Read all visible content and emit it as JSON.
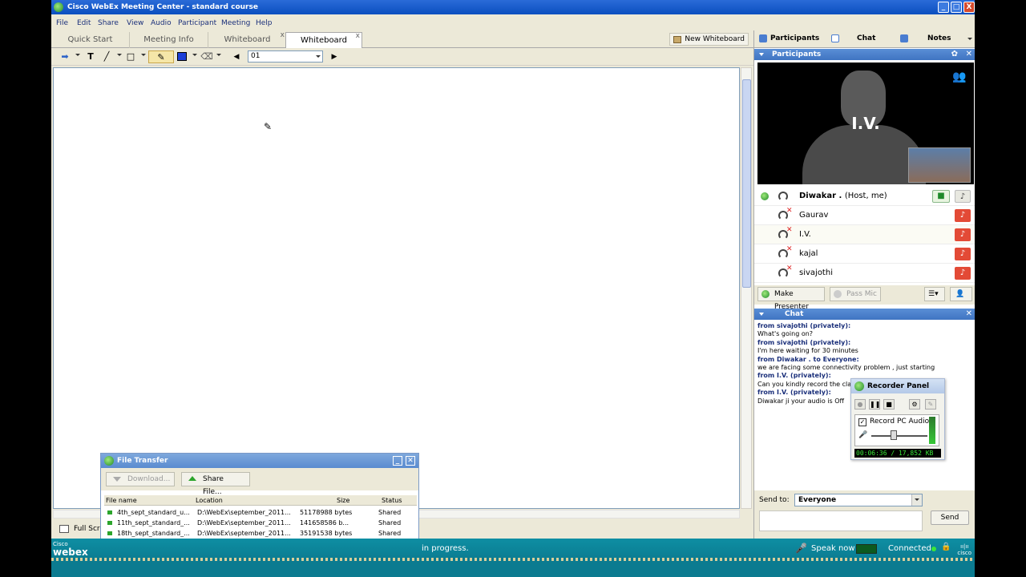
{
  "window": {
    "title": "Cisco WebEx Meeting Center - standard course",
    "buttons": [
      "_",
      "□",
      "X"
    ]
  },
  "menu": [
    "File",
    "Edit",
    "Share",
    "View",
    "Audio",
    "Participant",
    "Meeting",
    "Help"
  ],
  "tabs": [
    {
      "label": "Quick Start"
    },
    {
      "label": "Meeting Info"
    },
    {
      "label": "Whiteboard",
      "close": "x"
    },
    {
      "label": "Whiteboard",
      "close": "x"
    }
  ],
  "new_whiteboard": "New Whiteboard",
  "toolbar": {
    "page": "01",
    "icons": [
      "arrow-pointer-icon",
      "text-tool-icon",
      "line-tool-icon",
      "rectangle-tool-icon",
      "pen-tool-icon",
      "color-picker-icon",
      "eraser-icon"
    ]
  },
  "full_screen": "Full Scre",
  "right_tabs": [
    {
      "label": "Participants"
    },
    {
      "label": "Chat"
    },
    {
      "label": "Notes"
    }
  ],
  "participants_panel": {
    "title": "Participants",
    "video_initials": "I.V.",
    "rows": [
      {
        "name": "Diwakar .",
        "role": "(Host, me)",
        "host": true
      },
      {
        "name": "Gaurav"
      },
      {
        "name": "I.V."
      },
      {
        "name": "kajal"
      },
      {
        "name": "sivajothi"
      }
    ],
    "make_presenter": "Make Presenter",
    "pass_mic": "Pass Mic"
  },
  "chat_panel": {
    "title": "Chat",
    "messages": [
      {
        "from": "from sivajothi (privately):",
        "text": "What's going on?"
      },
      {
        "from": "from sivajothi (privately):",
        "text": "I'm here waiting for 30 minutes"
      },
      {
        "from": "from Diwakar . to Everyone:",
        "text": "we are facing some connectivity problem , just starting"
      },
      {
        "from": "from I.V. (privately):",
        "text": "Can you kindly record the clas"
      },
      {
        "from": "from I.V. (privately):",
        "text": "Diwakar ji your audio is Off"
      }
    ],
    "send_to_label": "Send to:",
    "send_to_value": "Everyone",
    "send_button": "Send"
  },
  "recorder": {
    "title": "Recorder Panel",
    "record_label": "Record PC Audio",
    "time": "00:06:36 / 17,852 KB",
    "volume_level": 0.4
  },
  "file_transfer": {
    "title": "File Transfer",
    "download_label": "Download...",
    "share_label": "Share File...",
    "columns": [
      "File name",
      "Location",
      "Size",
      "Status"
    ],
    "files": [
      {
        "name": "4th_sept_standard_u...",
        "location": "D:\\WebEx\\september_2011...",
        "size": "51178988 bytes",
        "status": "Shared"
      },
      {
        "name": "11th_sept_standard_...",
        "location": "D:\\WebEx\\september_2011...",
        "size": "141658586 b...",
        "status": "Shared"
      },
      {
        "name": "18th_sept_standard_...",
        "location": "D:\\WebEx\\september_2011...",
        "size": "35191538 bytes",
        "status": "Shared"
      }
    ]
  },
  "status_bar": {
    "brand_top": "Cisco",
    "brand": "webex",
    "progress_text": "in progress.",
    "speak_now": "Speak now",
    "connected": "Connected",
    "cisco": "cisco"
  }
}
